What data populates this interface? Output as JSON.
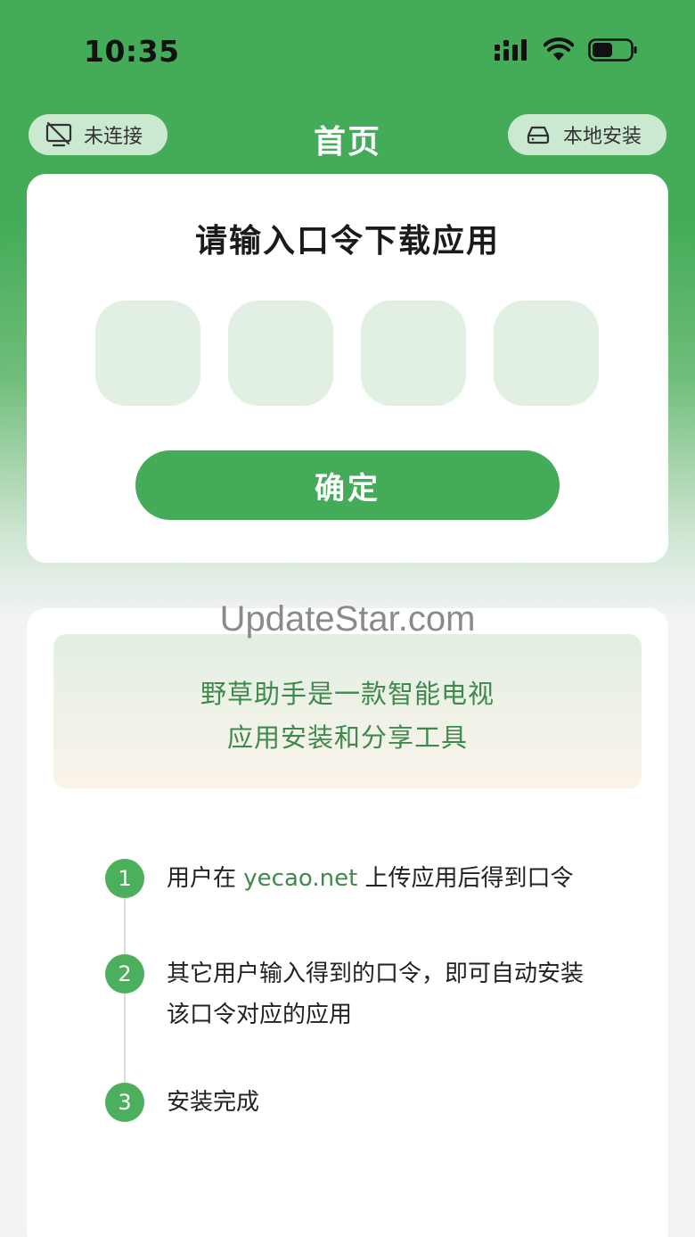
{
  "status_bar": {
    "time": "10:35"
  },
  "nav": {
    "left_button_label": "未连接",
    "title": "首页",
    "right_button_label": "本地安装"
  },
  "code_card": {
    "title": "请输入口令下载应用",
    "confirm_label": "确定"
  },
  "watermark": "UpdateStar.com",
  "intro": {
    "line1": "野草助手是一款智能电视",
    "line2": "应用安装和分享工具"
  },
  "steps": [
    {
      "number": "1",
      "text_before": "用户在 ",
      "link": "yecao.net",
      "text_after": " 上传应用后得到口令"
    },
    {
      "number": "2",
      "text": "其它用户输入得到的口令，即可自动安装该口令对应的应用"
    },
    {
      "number": "3",
      "text": "安装完成"
    }
  ],
  "colors": {
    "brand_green": "#44ac58",
    "link_green": "#3e8a4c"
  },
  "icons": [
    "signal-icon",
    "wifi-icon",
    "battery-icon",
    "tv-disconnected-icon",
    "drive-icon"
  ]
}
